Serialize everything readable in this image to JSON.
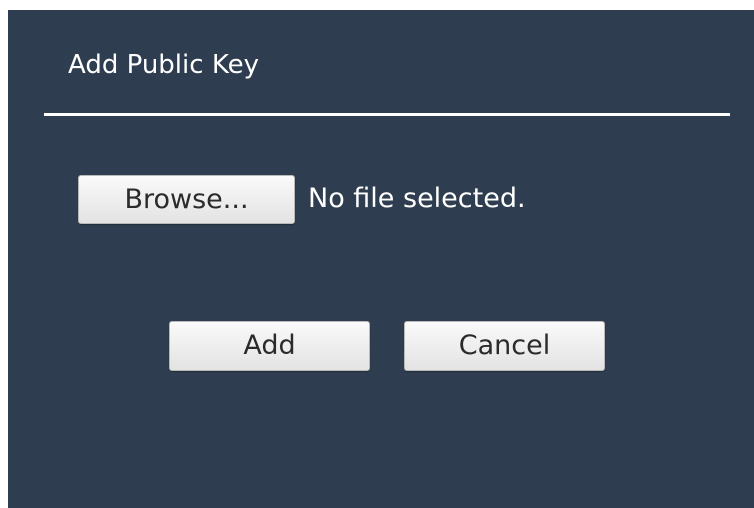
{
  "dialog": {
    "title": "Add Public Key",
    "file_input": {
      "browse_label": "Browse...",
      "status_text": "No file selected."
    },
    "actions": {
      "add_label": "Add",
      "cancel_label": "Cancel"
    }
  },
  "colors": {
    "dialog_background": "#2e3d4f",
    "page_background": "#ffffff",
    "title_text": "#ffffff",
    "divider": "#ffffff",
    "button_background": "#f0f0f0",
    "button_text": "#2b2b2b"
  }
}
